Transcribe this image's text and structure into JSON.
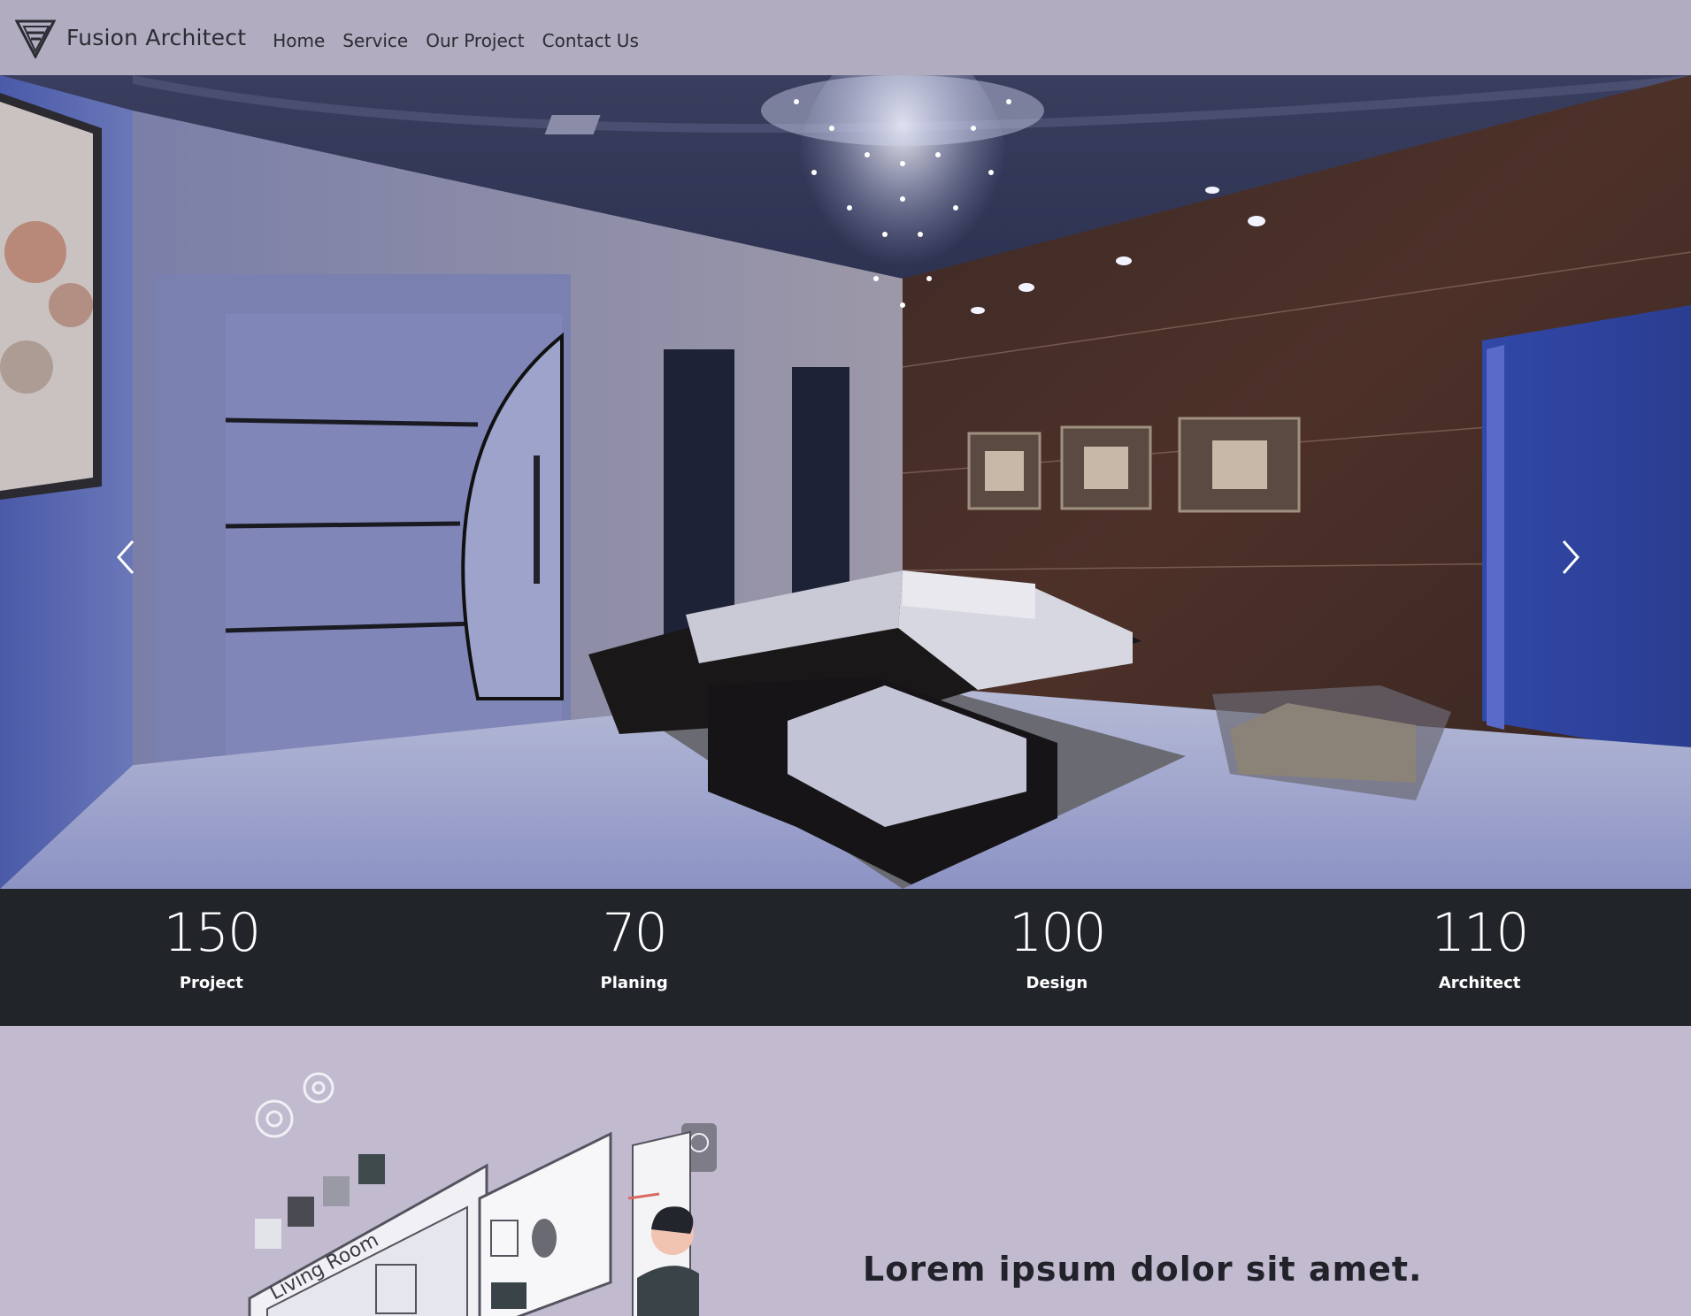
{
  "navbar": {
    "brand_name": "Fusion Architect",
    "logo_icon": "triangle-logo-icon",
    "links": [
      {
        "label": "Home"
      },
      {
        "label": "Service"
      },
      {
        "label": "Our Project"
      },
      {
        "label": "Contact Us"
      }
    ]
  },
  "hero": {
    "image": "luxury-living-room-interior",
    "prev_icon": "chevron-left-icon",
    "next_icon": "chevron-right-icon"
  },
  "stats": [
    {
      "number": "150",
      "label": "Project"
    },
    {
      "number": "70",
      "label": "Planing"
    },
    {
      "number": "100",
      "label": "Design"
    },
    {
      "number": "110",
      "label": "Architect"
    }
  ],
  "about": {
    "illustration": "architect-designing-living-room-illustration",
    "illustration_text": "Living Room",
    "heading": "Lorem ipsum dolor sit amet."
  },
  "colors": {
    "navbar_bg": "#b1acbf",
    "stats_bg": "#212429",
    "section_bg": "#c2bbd0",
    "text_dark": "#22222a"
  }
}
